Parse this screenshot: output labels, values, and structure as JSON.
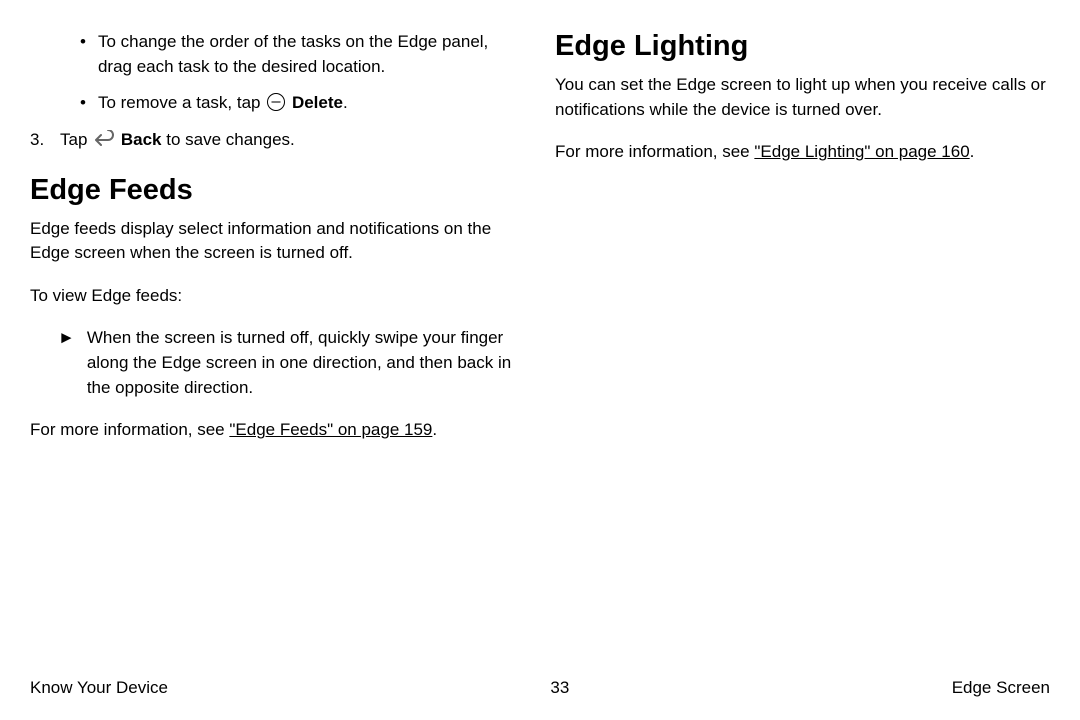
{
  "col1": {
    "bullet1": "To change the order of the tasks on the Edge panel, drag each task to the desired location.",
    "bullet2_prefix": "To remove a task, tap ",
    "bullet2_bold": "Delete",
    "bullet2_suffix": ".",
    "step3_num": "3.",
    "step3_prefix": "Tap ",
    "step3_bold": "Back",
    "step3_suffix": " to save changes.",
    "heading": "Edge Feeds",
    "para1": "Edge feeds display select information and notifications on the Edge screen when the screen is turned off.",
    "para2": "To view Edge feeds:",
    "triangle": "►",
    "tri_text": "When the screen is turned off, quickly swipe your finger along the Edge screen in one direction, and then back in the opposite direction.",
    "moreinfo_prefix": "For more information, see ",
    "moreinfo_link": "\"Edge Feeds\" on page 159",
    "moreinfo_suffix": "."
  },
  "col2": {
    "heading": "Edge Lighting",
    "para1": "You can set the Edge screen to light up when you receive calls or notifications while the device is turned over.",
    "moreinfo_prefix": "For more information, see ",
    "moreinfo_link": "\"Edge Lighting\" on page 160",
    "moreinfo_suffix": "."
  },
  "footer": {
    "left": "Know Your Device",
    "center": "33",
    "right": "Edge Screen"
  }
}
